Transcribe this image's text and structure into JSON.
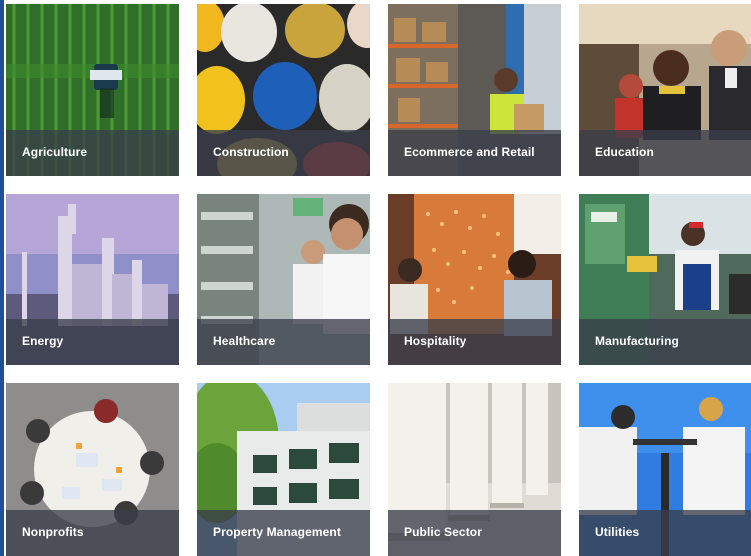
{
  "industries": [
    {
      "label": "Agriculture"
    },
    {
      "label": "Construction"
    },
    {
      "label": "Ecommerce and Retail"
    },
    {
      "label": "Education"
    },
    {
      "label": "Energy"
    },
    {
      "label": "Healthcare"
    },
    {
      "label": "Hospitality"
    },
    {
      "label": "Manufacturing"
    },
    {
      "label": "Nonprofits"
    },
    {
      "label": "Property Management"
    },
    {
      "label": "Public Sector"
    },
    {
      "label": "Utilities"
    }
  ],
  "colors": {
    "caption_overlay": "#3a3e4a",
    "caption_text": "#ffffff",
    "accent_edge": "#1f4f96"
  }
}
